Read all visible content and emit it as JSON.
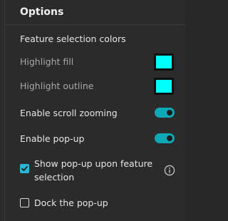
{
  "section": {
    "title": "Options"
  },
  "feature_selection": {
    "heading": "Feature selection colors",
    "highlight_fill": {
      "label": "Highlight fill",
      "color": "#00ffff"
    },
    "highlight_outline": {
      "label": "Highlight outline",
      "color": "#00ffff"
    }
  },
  "toggles": {
    "scroll_zoom": {
      "label": "Enable scroll zooming",
      "enabled": true
    },
    "popup": {
      "label": "Enable pop-up",
      "enabled": true
    }
  },
  "checkboxes": {
    "show_popup": {
      "label_line1": "Show pop-up upon feature",
      "label_line2": "selection",
      "checked": true
    },
    "dock_popup": {
      "label": "Dock the pop-up",
      "checked": false
    }
  },
  "icons": {
    "info": "info-icon",
    "check": "checkmark-icon"
  },
  "colors": {
    "accent": "#0da8b8",
    "checkbox_accent": "#29b6d6",
    "background": "#2b2b2b"
  }
}
